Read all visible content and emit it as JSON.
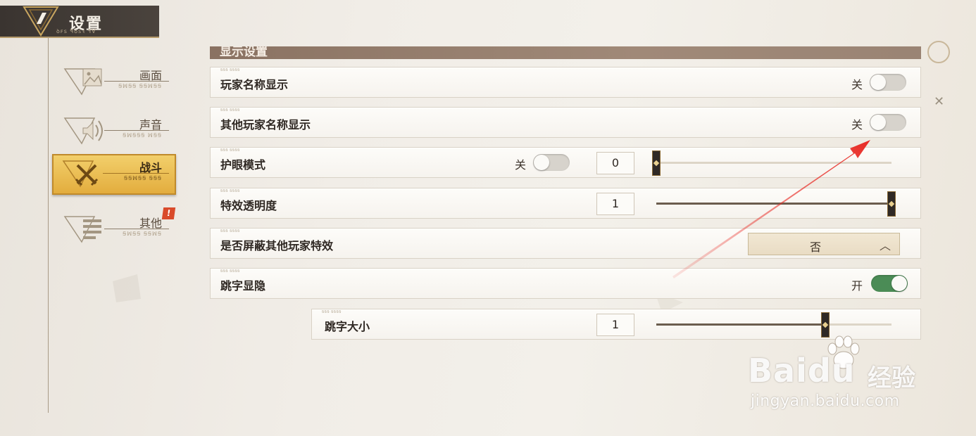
{
  "header": {
    "title": "设置",
    "subtitle": "ꝺꜰꜱ ꟼꝺꜱꝛ ꟻⱯ"
  },
  "sidebar": {
    "items": [
      {
        "label": "画面",
        "sub": "ꞨꟽꞨꞨ ꞨꞨꟽꞨꞨ",
        "icon": "image-icon",
        "active": false
      },
      {
        "label": "声音",
        "sub": "ꞨꟽꞨꞨꞨ ꟽꞨꞨ",
        "icon": "sound-icon",
        "active": false
      },
      {
        "label": "战斗",
        "sub": "ꞨꞨꟽꞨꞨ ꞨꞨꞨ",
        "icon": "crossed-swords-icon",
        "active": true
      },
      {
        "label": "其他",
        "sub": "ꞨꟽꞨꞨ ꞨꞨꟽꞨ",
        "icon": "list-icon",
        "active": false,
        "badge": "!"
      }
    ]
  },
  "section": {
    "title": "显示设置"
  },
  "rows": {
    "player_name": {
      "label": "玩家名称显示",
      "toggle_text": "关",
      "toggle_on": false
    },
    "other_player_name": {
      "label": "其他玩家名称显示",
      "toggle_text": "关",
      "toggle_on": false
    },
    "eye_mode": {
      "label": "护眼模式",
      "toggle_text": "关",
      "toggle_on": false,
      "value": "0",
      "slider_fraction": 0.0
    },
    "effect_opacity": {
      "label": "特效透明度",
      "value": "1",
      "slider_fraction": 1.0
    },
    "block_effects": {
      "label": "是否屏蔽其他玩家特效",
      "selected": "否"
    },
    "damage_numbers": {
      "label": "跳字显隐",
      "toggle_text": "开",
      "toggle_on": true
    },
    "damage_size": {
      "label": "跳字大小",
      "value": "1",
      "slider_fraction": 0.72
    }
  },
  "row_tag": "ꞨꞨꞨ ꞨꞨꞨꞨ",
  "watermark": {
    "brand": "Bai",
    "brand_suffix": "du",
    "cn": "经验",
    "url": "jingyan.baidu.com"
  },
  "colors": {
    "accent": "#e3ad3e",
    "toggle_on": "#4b8c56",
    "arrow": "#e82a24"
  }
}
